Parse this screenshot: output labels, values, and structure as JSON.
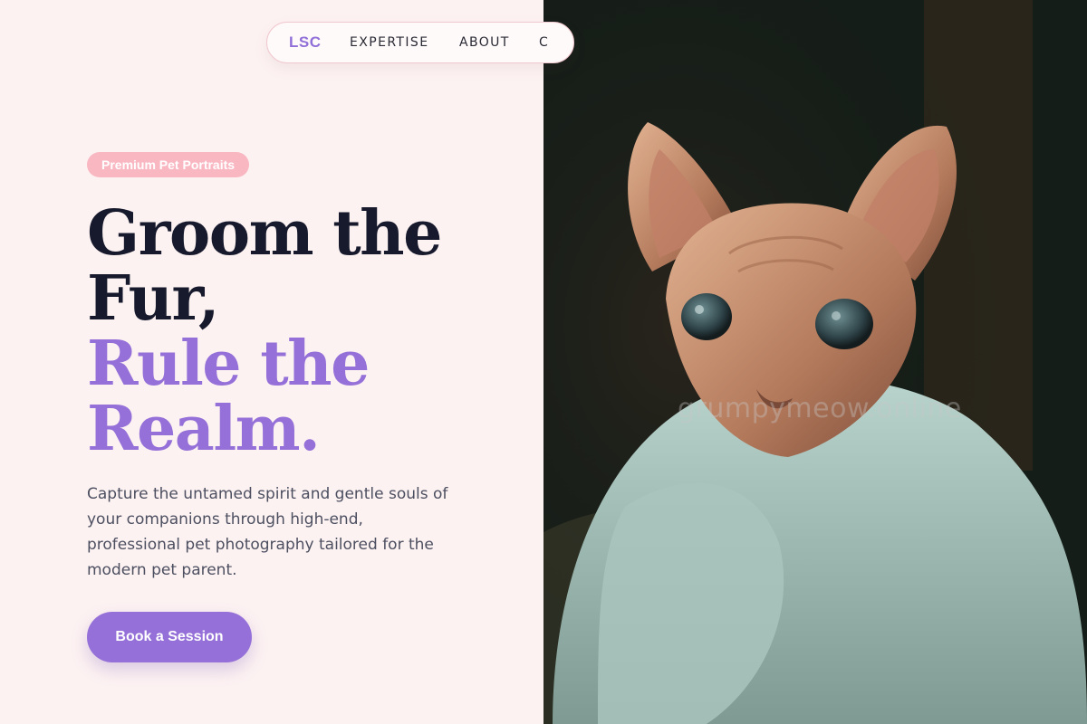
{
  "nav": {
    "logo": "LSC",
    "links": [
      "EXPERTISE",
      "ABOUT",
      "C"
    ]
  },
  "hero": {
    "badge": "Premium Pet Portraits",
    "headline_line1": "Groom the",
    "headline_line2": "Fur,",
    "headline_accent_line1": "Rule the",
    "headline_accent_line2": "Realm.",
    "description": "Capture the untamed spirit and gentle souls of your companions through high-end, professional pet photography tailored for the modern pet parent.",
    "cta_label": "Book a Session"
  },
  "photo": {
    "watermark": "grumpymeow.online",
    "subject": "sphynx-cat-in-sweater"
  },
  "colors": {
    "accent": "#9570d8",
    "badge": "#f9b7c2",
    "background": "#fdf2f2",
    "headline": "#161a2c"
  }
}
